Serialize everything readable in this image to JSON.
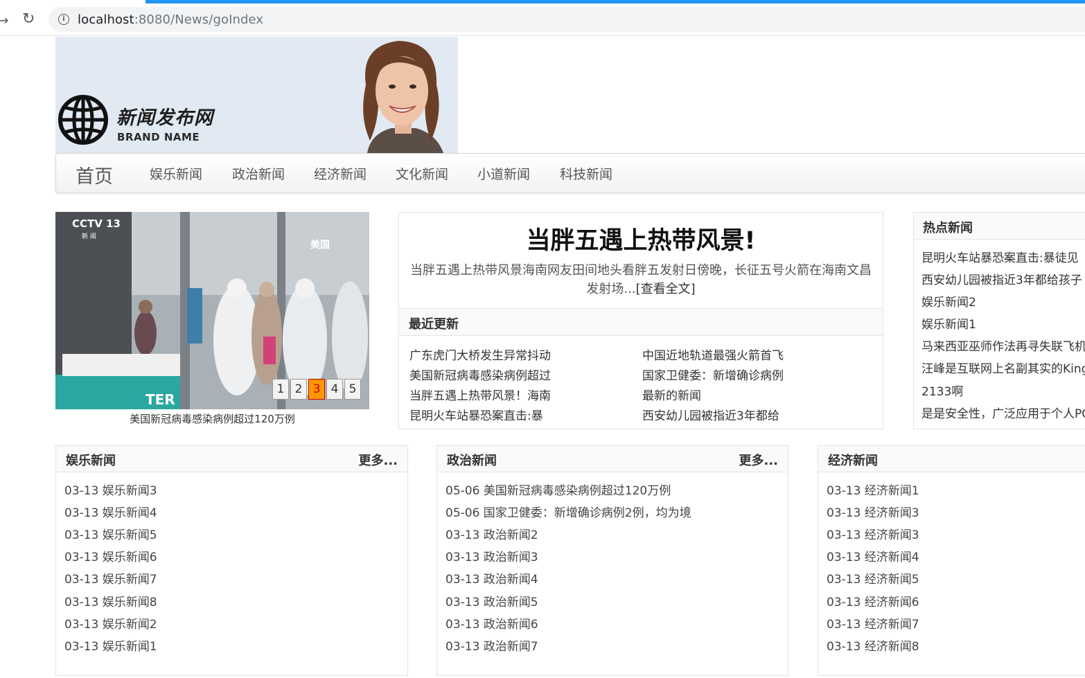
{
  "browser": {
    "url_host": "localhost",
    "url_rest": ":8080/News/goIndex"
  },
  "banner": {
    "brand_cn": "新闻发布网",
    "brand_en": "BRAND NAME"
  },
  "navbar": {
    "brand": "首页",
    "items": [
      "娱乐新闻",
      "政治新闻",
      "经济新闻",
      "文化新闻",
      "小道新闻",
      "科技新闻"
    ]
  },
  "carousel": {
    "caption": "美国新冠病毒感染病例超过120万例",
    "pages": [
      "1",
      "2",
      "3",
      "4",
      "5"
    ],
    "active_page": "3",
    "image_labels": {
      "logo": "CCTV 13",
      "sub": "新 闻",
      "tag": "美国",
      "sign": "TER"
    }
  },
  "headline": {
    "title": "当胖五遇上热带风景!",
    "summary": "当胖五遇上热带风景海南网友田间地头看胖五发射日傍晚，长征五号火箭在海南文昌发射场...",
    "read_more": "[查看全文]"
  },
  "recent": {
    "title": "最近更新",
    "left": [
      "广东虎门大桥发生异常抖动",
      "美国新冠病毒感染病例超过",
      "当胖五遇上热带风景！海南",
      "昆明火车站暴恐案直击:暴"
    ],
    "right": [
      "中国近地轨道最强火箭首飞",
      "国家卫健委：新增确诊病例",
      "最新的新闻",
      "西安幼儿园被指近3年都给"
    ]
  },
  "hot": {
    "title": "热点新闻",
    "items": [
      "昆明火车站暴恐案直击:暴徒见",
      "西安幼儿园被指近3年都给孩子",
      "娱乐新闻2",
      "娱乐新闻1",
      "马来西亚巫师作法再寻失联飞机",
      "汪峰是互联网上名副其实的King",
      "2133啊",
      "是是安全性，广泛应用于个人PC"
    ]
  },
  "panels": [
    {
      "title": "娱乐新闻",
      "more": "更多...",
      "items": [
        "03-13 娱乐新闻3",
        "03-13 娱乐新闻4",
        "03-13 娱乐新闻5",
        "03-13 娱乐新闻6",
        "03-13 娱乐新闻7",
        "03-13 娱乐新闻8",
        "03-13 娱乐新闻2",
        "03-13 娱乐新闻1"
      ]
    },
    {
      "title": "政治新闻",
      "more": "更多...",
      "items": [
        "05-06 美国新冠病毒感染病例超过120万例",
        "05-06 国家卫健委：新增确诊病例2例，均为境",
        "03-13 政治新闻2",
        "03-13 政治新闻3",
        "03-13 政治新闻4",
        "03-13 政治新闻5",
        "03-13 政治新闻6",
        "03-13 政治新闻7"
      ]
    },
    {
      "title": "经济新闻",
      "more": "",
      "items": [
        "03-13 经济新闻1",
        "03-13 经济新闻3",
        "03-13 经济新闻3",
        "03-13 经济新闻4",
        "03-13 经济新闻5",
        "03-13 经济新闻6",
        "03-13 经济新闻7",
        "03-13 经济新闻8"
      ]
    }
  ]
}
